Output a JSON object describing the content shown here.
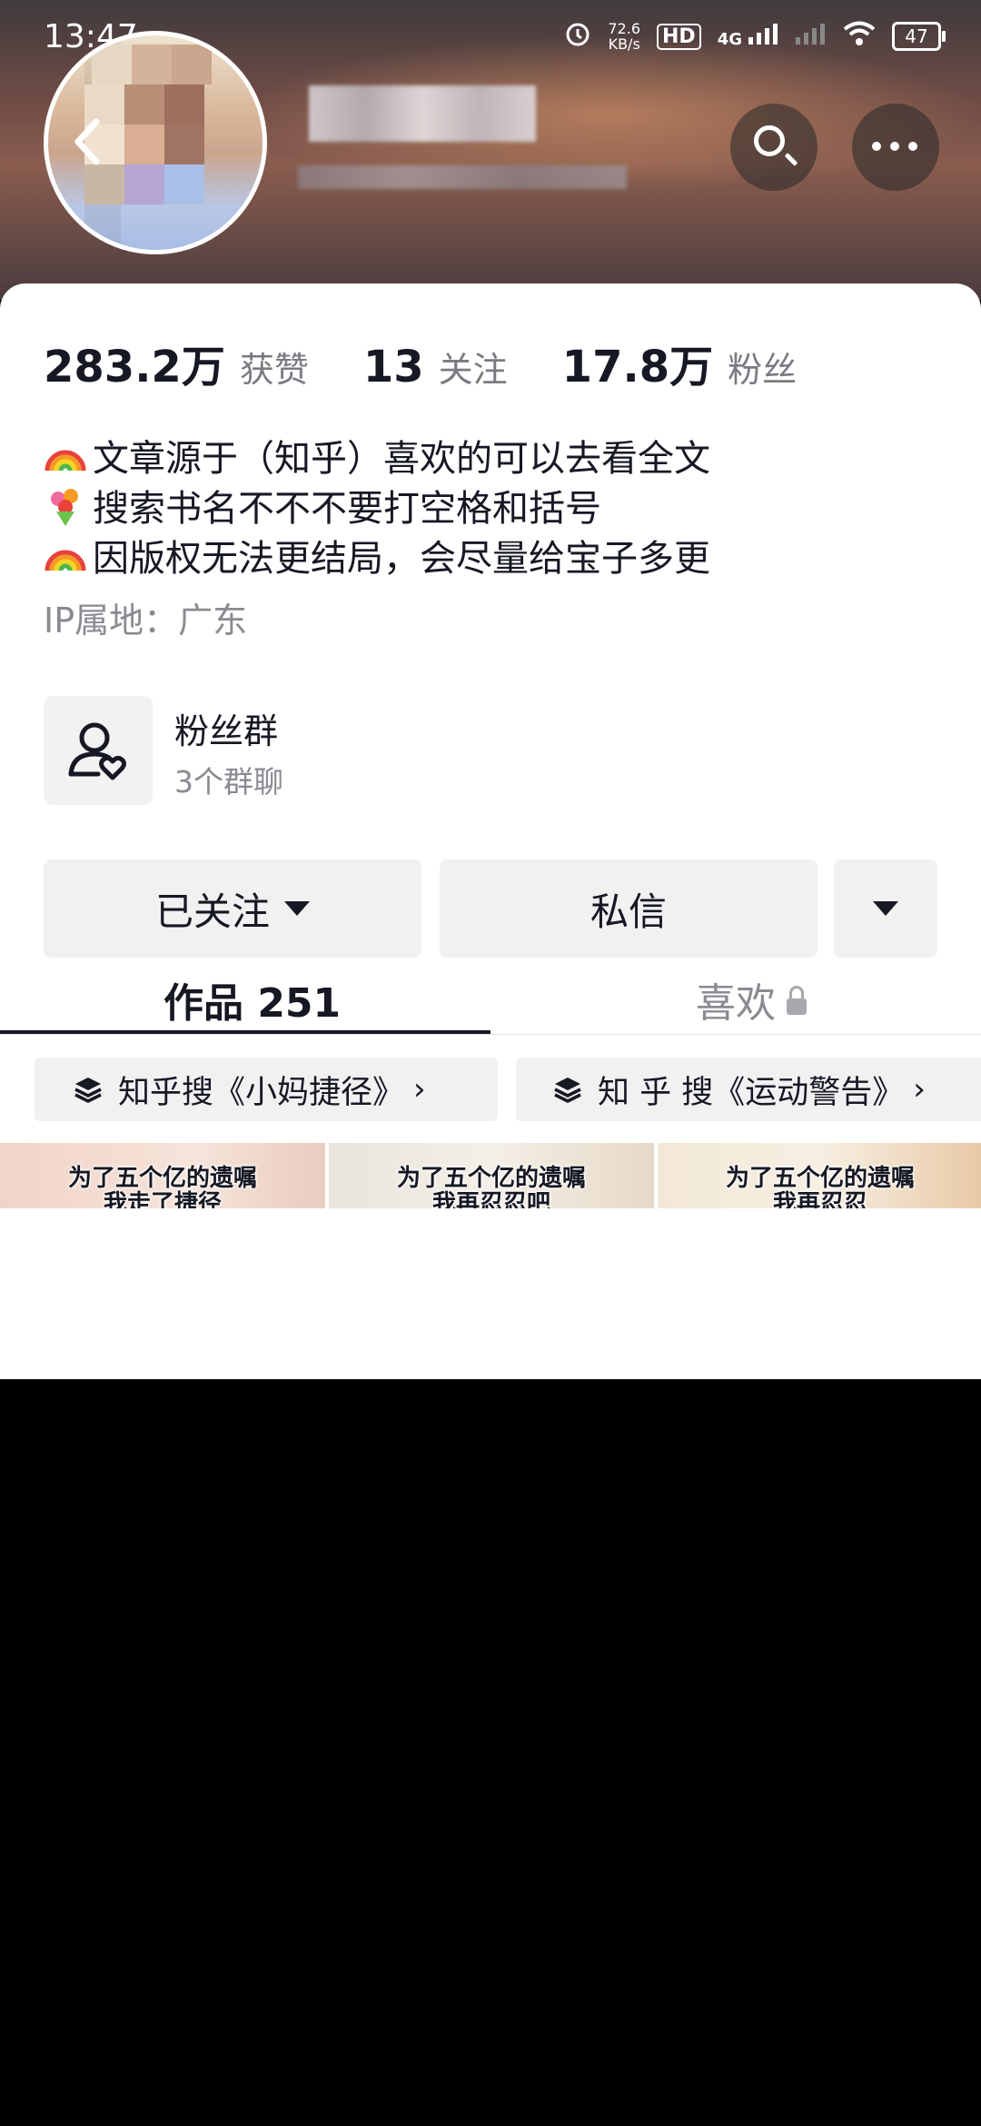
{
  "status_bar": {
    "time": "13:47",
    "net_speed_value": "72.6",
    "net_speed_unit": "KB/s",
    "hd_label": "HD",
    "network_label": "4G",
    "battery": "47"
  },
  "profile": {
    "stats": [
      {
        "value": "283.2万",
        "label": "获赞"
      },
      {
        "value": "13",
        "label": "关注"
      },
      {
        "value": "17.8万",
        "label": "粉丝"
      }
    ],
    "bio": [
      {
        "emoji": "rainbow",
        "text": "文章源于（知乎）喜欢的可以去看全文"
      },
      {
        "emoji": "bouquet",
        "text": "搜索书名不不不要打空格和括号"
      },
      {
        "emoji": "rainbow",
        "text": "因版权无法更结局，会尽量给宝子多更"
      }
    ],
    "ip_location": "IP属地：广东",
    "fan_group": {
      "title": "粉丝群",
      "subtitle": "3个群聊"
    }
  },
  "actions": {
    "follow_label": "已关注",
    "message_label": "私信"
  },
  "tabs": [
    {
      "label": "作品 251",
      "active": true
    },
    {
      "label": "喜欢",
      "locked": true
    }
  ],
  "collections": [
    {
      "label": "知乎搜《小妈捷径》"
    },
    {
      "label": "知 乎 搜《运动警告》"
    }
  ],
  "videos": [
    {
      "caption_line1": "为了五个亿的遗嘱",
      "caption_line2": "我走了捷径"
    },
    {
      "caption_line1": "为了五个亿的遗嘱",
      "caption_line2": "我再忍忍吧"
    },
    {
      "caption_line1": "为了五个亿的遗嘱",
      "caption_line2": "我再忍忍"
    }
  ],
  "icons": {
    "back": "chevron-left-icon",
    "search": "search-icon",
    "more": "more-dots-icon",
    "fan_group": "user-heart-icon",
    "collection": "stack-layers-icon",
    "lock": "lock-icon"
  }
}
